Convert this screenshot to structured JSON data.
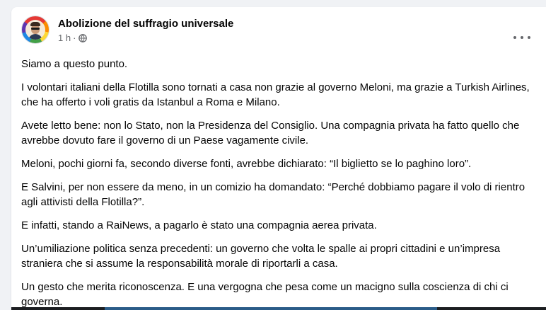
{
  "post": {
    "page_name": "Abolizione del suffragio universale",
    "time": "1 h",
    "separator": "·",
    "privacy_icon": "globe-icon",
    "more_icon": "more-options-icon",
    "paragraphs": [
      "Siamo a questo punto.",
      "I volontari italiani della Flotilla sono tornati a casa non grazie al governo Meloni, ma grazie a Turkish Airlines, che ha offerto i voli gratis da Istanbul a Roma e Milano.",
      "Avete letto bene: non lo Stato, non la Presidenza del Consiglio. Una compagnia privata ha fatto quello che avrebbe dovuto fare il governo di un Paese vagamente civile.",
      "Meloni, pochi giorni fa, secondo diverse fonti, avrebbe dichiarato: “Il biglietto se lo paghino loro”.",
      "E Salvini, per non essere da meno, in un comizio ha domandato: “Perché dobbiamo pagare il volo di rientro agli attivisti della Flotilla?”.",
      "E infatti, stando a RaiNews, a pagarlo è stato una compagnia aerea privata.",
      "Un’umiliazione politica senza precedenti: un governo che volta le spalle ai propri cittadini e un’impresa straniera che si assume la responsabilità morale di riportarli a casa.",
      "Un gesto che merita riconoscenza. E una vergogna che pesa come un macigno sulla coscienza di chi ci governa."
    ]
  },
  "colors": {
    "background": "#f0f2f5",
    "card": "#ffffff",
    "text": "#050505",
    "secondary_text": "#65676b"
  }
}
